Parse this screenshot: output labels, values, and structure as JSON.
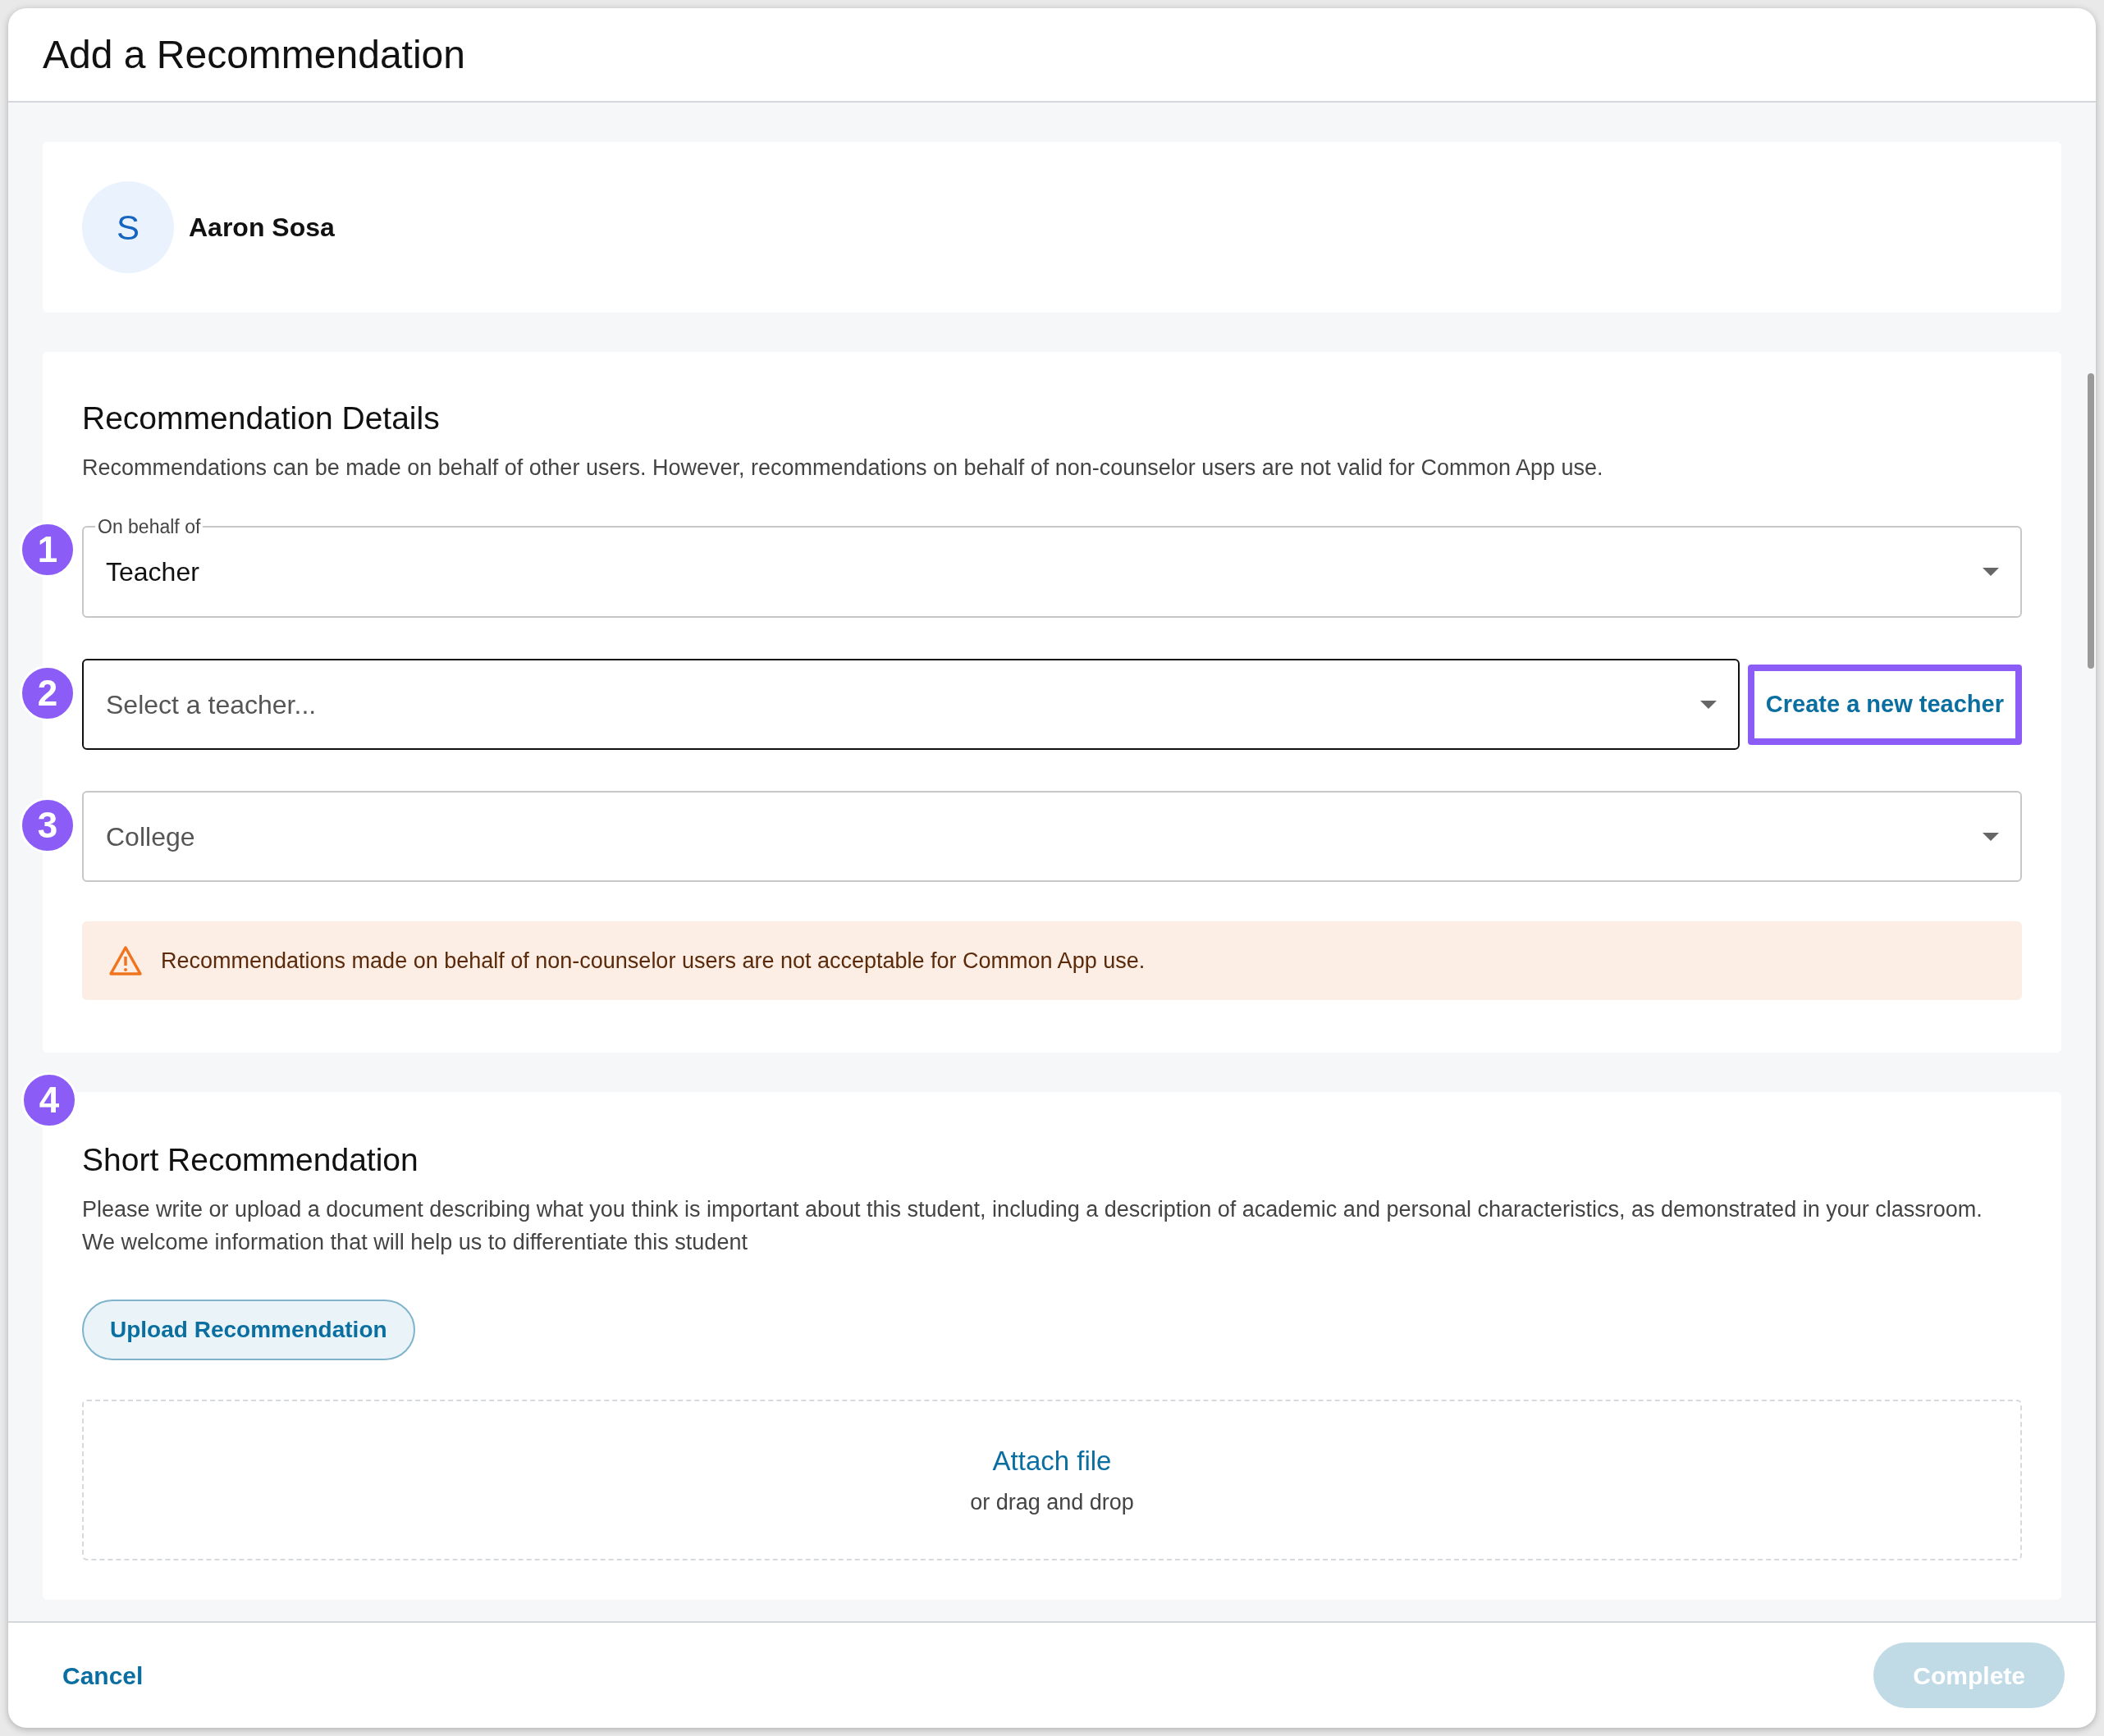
{
  "dialog": {
    "title": "Add a Recommendation"
  },
  "student": {
    "initial": "S",
    "name": "Aaron Sosa"
  },
  "details": {
    "heading": "Recommendation Details",
    "description": "Recommendations can be made on behalf of other users. However, recommendations on behalf of non-counselor users are not valid for Common App use.",
    "fields": [
      {
        "step": "1",
        "label": "On behalf of",
        "value": "Teacher",
        "focused": false
      },
      {
        "step": "2",
        "placeholder": "Select a teacher...",
        "focused": true,
        "action": {
          "label": "Create a new teacher",
          "highlighted": true
        }
      },
      {
        "step": "3",
        "placeholder": "College",
        "focused": false
      }
    ],
    "warning": "Recommendations made on behalf of non-counselor users are not acceptable for Common App use."
  },
  "short": {
    "step": "4",
    "heading": "Short Recommendation",
    "description": "Please write or upload a document describing what you think is important about this student, including a description of academic and personal characteristics, as demonstrated in your classroom. We welcome information that will help us to differentiate this student",
    "upload_button": "Upload Recommendation",
    "dropzone": {
      "link": "Attach file",
      "hint": "or drag and drop"
    }
  },
  "footer": {
    "cancel": "Cancel",
    "complete": {
      "label": "Complete",
      "disabled": true
    }
  }
}
